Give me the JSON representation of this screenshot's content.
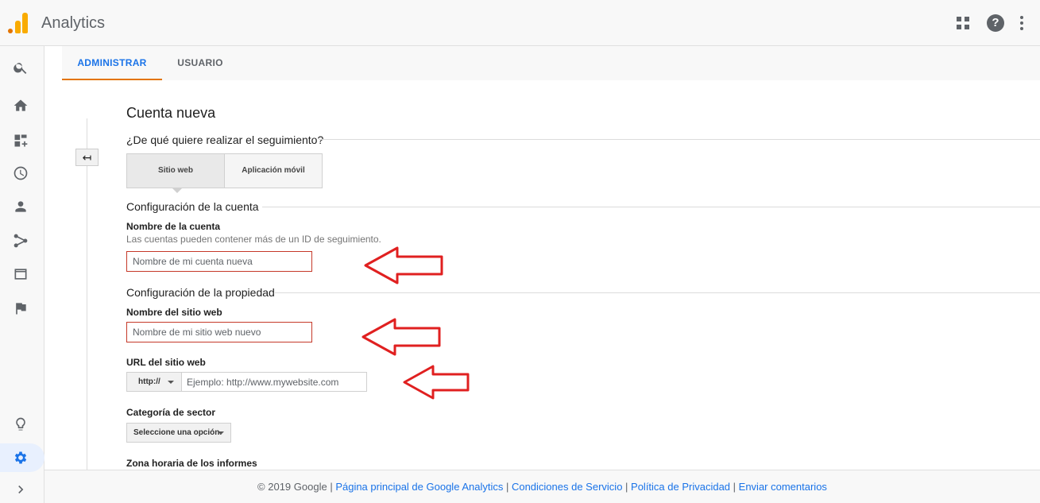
{
  "app": {
    "title": "Analytics"
  },
  "topbar": {
    "icons": [
      "apps-icon",
      "help-icon",
      "more-vert-icon"
    ],
    "help_glyph": "?"
  },
  "leftnav": {
    "icons": [
      "search-icon",
      "home-icon",
      "customization-icon",
      "realtime-icon",
      "audience-icon",
      "acquisition-icon",
      "behavior-icon",
      "conversions-icon",
      "discover-icon",
      "admin-gear-icon",
      "expand-icon"
    ],
    "active_color": "#1a73e8"
  },
  "tabs": [
    {
      "label": "ADMINISTRAR",
      "active": true
    },
    {
      "label": "USUARIO",
      "active": false
    }
  ],
  "form": {
    "back_glyph": "↤",
    "title": "Cuenta nueva",
    "tracking_question": "¿De qué quiere realizar el seguimiento?",
    "segment": {
      "web_label": "Sitio web",
      "mobile_label": "Aplicación móvil",
      "selected": "Sitio web"
    },
    "account_section": "Configuración de la cuenta",
    "account_name_label": "Nombre de la cuenta",
    "account_name_help": "Las cuentas pueden contener más de un ID de seguimiento.",
    "account_name_placeholder": "Nombre de mi cuenta nueva",
    "property_section": "Configuración de la propiedad",
    "site_name_label": "Nombre del sitio web",
    "site_name_placeholder": "Nombre de mi sitio web nuevo",
    "url_label": "URL del sitio web",
    "url_protocol": "http://",
    "url_placeholder": "Ejemplo: http://www.mywebsite.com",
    "sector_label": "Categoría de sector",
    "sector_select": "Seleccione una opción.",
    "timezone_label": "Zona horaria de los informes"
  },
  "footer": {
    "copyright": "© 2019 Google",
    "sep": " | ",
    "links": [
      "Página principal de Google Analytics",
      "Condiciones de Servicio",
      "Política de Privacidad",
      "Enviar comentarios"
    ]
  },
  "colors": {
    "accent": "#1a73e8",
    "tab_underline": "#e37400",
    "annotation_arrow": "#e02020",
    "input_error_border": "#c53929"
  }
}
